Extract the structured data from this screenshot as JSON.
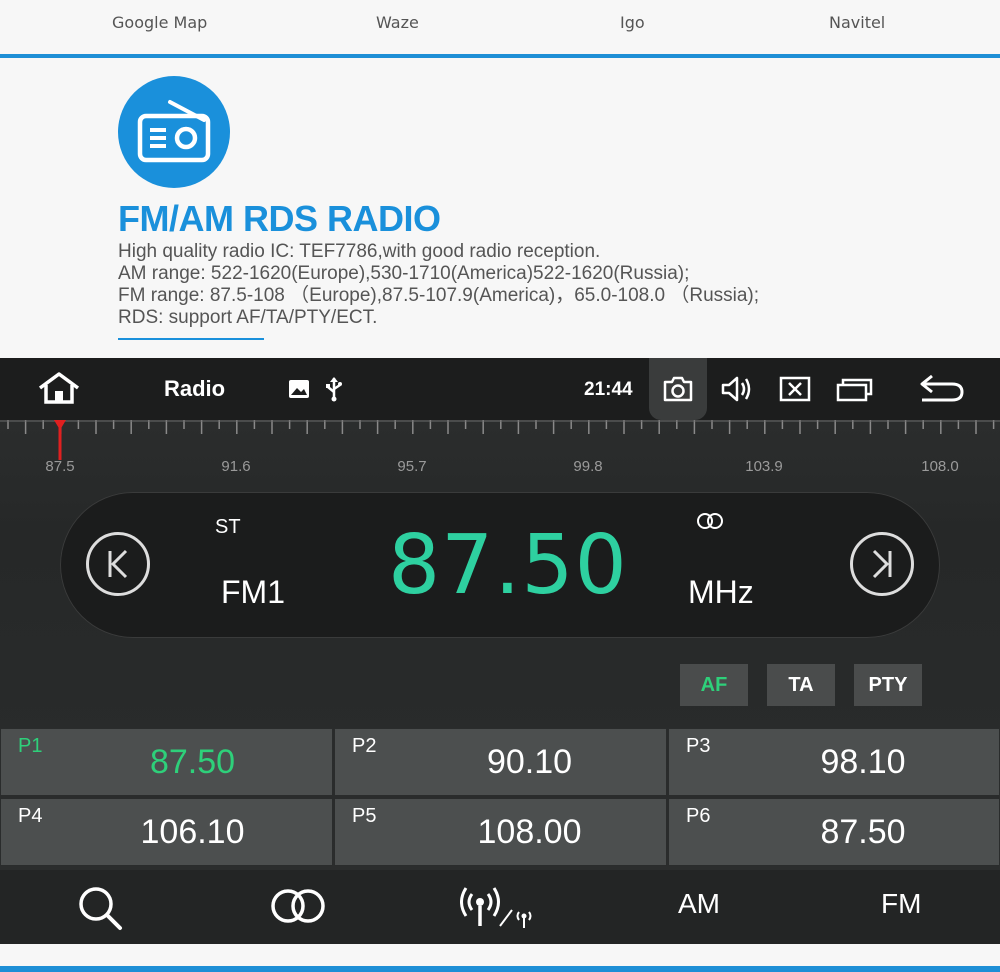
{
  "top_nav": {
    "items": [
      "Google Map",
      "Waze",
      "Igo",
      "Navitel"
    ]
  },
  "promo": {
    "title": "FM/AM RDS RADIO",
    "lines": [
      "High quality radio IC: TEF7786,with good radio reception.",
      "AM range: 522-1620(Europe),530-1710(America)522-1620(Russia);",
      "FM range: 87.5-108 （Europe),87.5-107.9(America)，65.0-108.0 （Russia);",
      "RDS: support AF/TA/PTY/ECT."
    ],
    "icon": "radio-icon"
  },
  "status_bar": {
    "title": "Radio",
    "time": "21:44",
    "icons": [
      "home-icon",
      "image-icon",
      "usb-icon",
      "camera-icon",
      "volume-icon",
      "close-window-icon",
      "multitask-icon",
      "back-icon"
    ]
  },
  "tuner": {
    "scale_labels": [
      "87.5",
      "91.6",
      "95.7",
      "99.8",
      "103.9",
      "108.0"
    ],
    "needle_value": 87.5,
    "range": [
      87.5,
      108.0
    ]
  },
  "display": {
    "stereo": "ST",
    "band": "FM1",
    "frequency": "87.50",
    "unit": "MHz"
  },
  "toggles": [
    {
      "label": "AF",
      "active": true
    },
    {
      "label": "TA",
      "active": false
    },
    {
      "label": "PTY",
      "active": false
    }
  ],
  "presets": [
    {
      "name": "P1",
      "value": "87.50",
      "active": true
    },
    {
      "name": "P2",
      "value": "90.10",
      "active": false
    },
    {
      "name": "P3",
      "value": "98.10",
      "active": false
    },
    {
      "name": "P4",
      "value": "106.10",
      "active": false
    },
    {
      "name": "P5",
      "value": "108.00",
      "active": false
    },
    {
      "name": "P6",
      "value": "87.50",
      "active": false
    }
  ],
  "bottom_bar": {
    "am_label": "AM",
    "fm_label": "FM",
    "icons": [
      "search-icon",
      "stereo-icon",
      "broadcast-icon"
    ]
  },
  "colors": {
    "accent_blue": "#1a90db",
    "frequency_green": "#2ed0a0",
    "active_green": "#2ed07a"
  }
}
